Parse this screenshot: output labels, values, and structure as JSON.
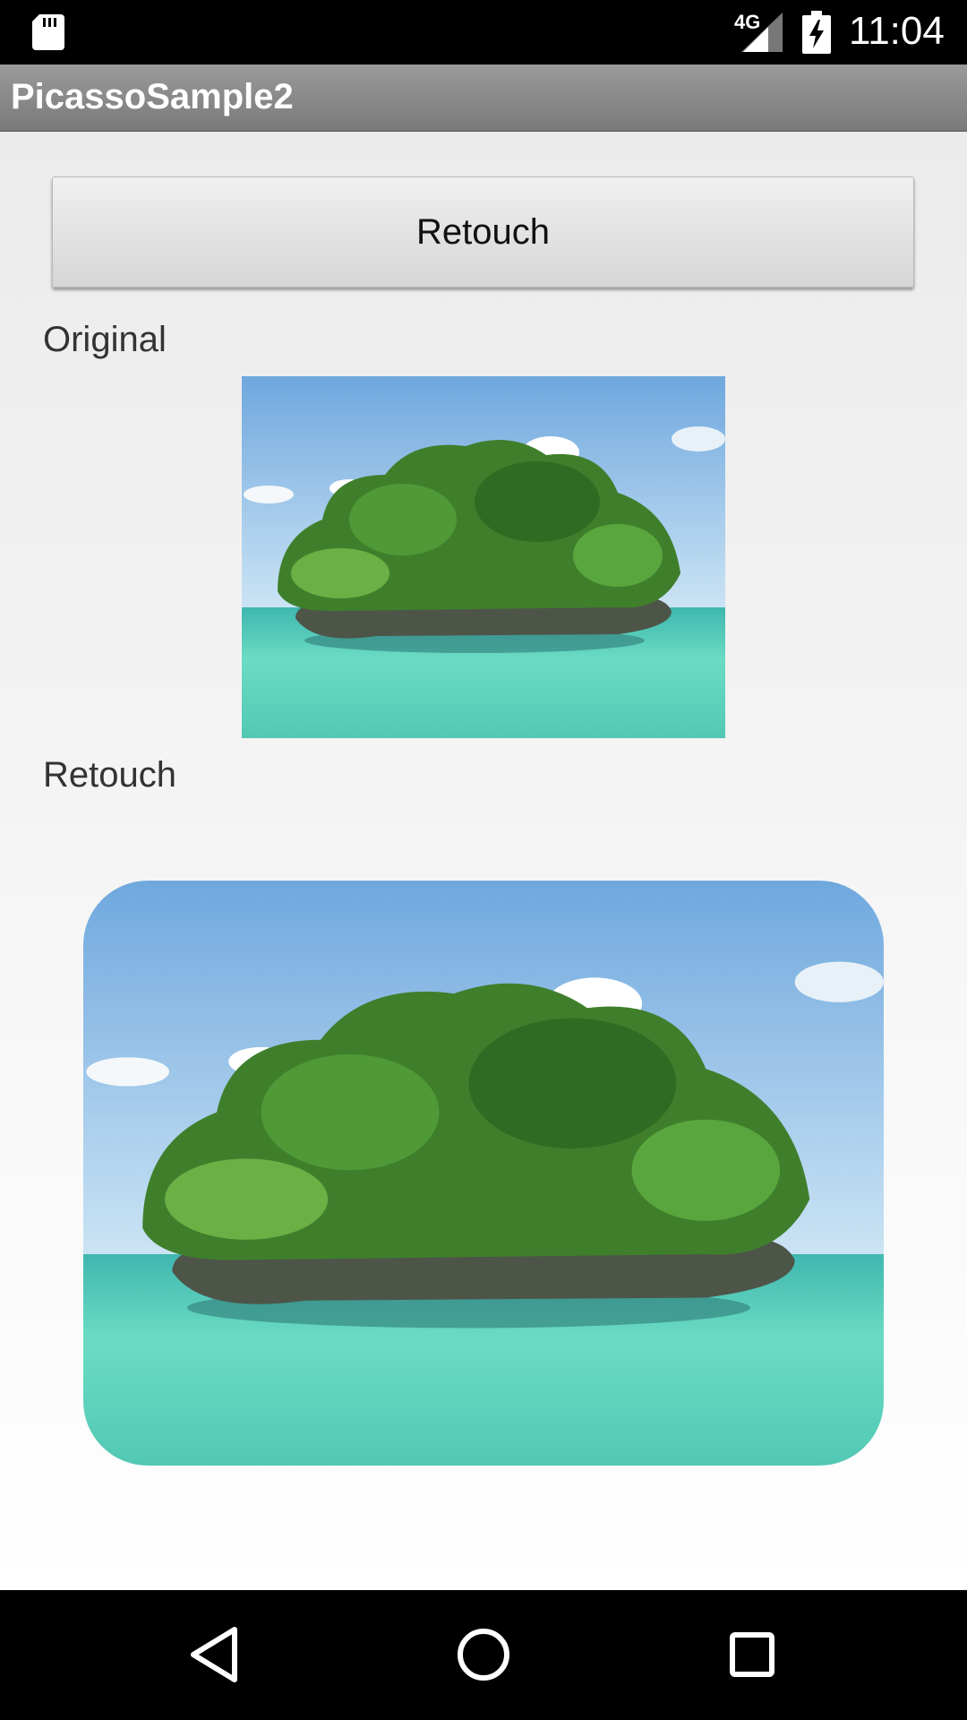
{
  "status_bar": {
    "network": "4G",
    "time": "11:04",
    "icons": [
      "sd-card-icon",
      "cell-signal-icon",
      "battery-charging-icon"
    ]
  },
  "app_bar": {
    "title": "PicassoSample2"
  },
  "main": {
    "retouch_button_label": "Retouch",
    "original_label": "Original",
    "retouch_label": "Retouch"
  },
  "nav_bar": {
    "icons": [
      "back-icon",
      "home-icon",
      "recents-icon"
    ]
  },
  "colors": {
    "action_bar": "#8a8a8a",
    "content_bg": "#f0f0f0",
    "sky": "#8cc0ea",
    "water": "#5fd2be",
    "foliage": "#3f7f2c"
  }
}
